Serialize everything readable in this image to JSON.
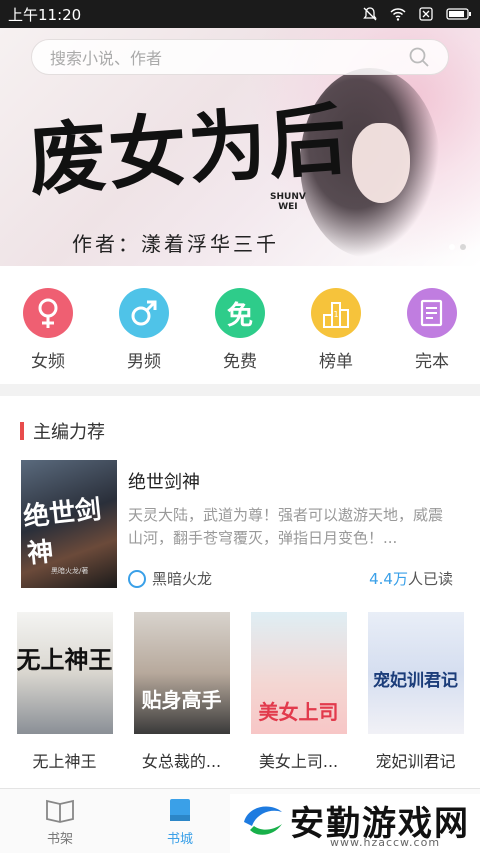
{
  "status_bar": {
    "time": "上午11:20"
  },
  "search": {
    "placeholder": "搜索小说、作者"
  },
  "banner": {
    "title": "废女为后",
    "pinyin_top": "SHUNV",
    "pinyin_bottom": "WEI",
    "author_line": "作者：漾着浮华三千"
  },
  "categories": [
    {
      "label": "女频",
      "color": "#ef5f72",
      "icon": "female-icon"
    },
    {
      "label": "男频",
      "color": "#4fc3e8",
      "icon": "male-icon"
    },
    {
      "label": "免费",
      "color": "#2ecc8a",
      "icon": "free-icon"
    },
    {
      "label": "榜单",
      "color": "#f6c33b",
      "icon": "ranking-icon"
    },
    {
      "label": "完本",
      "color": "#c07de0",
      "icon": "book-complete-icon"
    }
  ],
  "section": {
    "title": "主编力荐"
  },
  "featured": {
    "title": "绝世剑神",
    "description": "天灵大陆，武道为尊！强者可以遨游天地，威震山河，翻手苍穹覆灭，弹指日月变色！...",
    "author": "黑暗火龙",
    "reads_num": "4.4万",
    "reads_suffix": "人已读",
    "cover_title": "绝世剑神",
    "cover_sub": "黑暗火龙/著"
  },
  "books": [
    {
      "title": "无上神王",
      "cover_text": "无上神王",
      "cover_bg": "linear-gradient(180deg,#f4f4f2 0%,#d9d6cf 50%,#8a8f96 100%)",
      "cover_color": "#111"
    },
    {
      "title": "女总裁的...",
      "cover_text": "贴身高手",
      "cover_bg": "linear-gradient(180deg,#d8d3cd 0%,#b7a99c 50%,#3a3a3a 100%)",
      "cover_color": "#fff"
    },
    {
      "title": "美女上司...",
      "cover_text": "美女上司",
      "cover_bg": "linear-gradient(180deg,#dfeef4 0%,#f4d6d2 60%,#f7c6c6 100%)",
      "cover_color": "#e23a4c"
    },
    {
      "title": "宠妃训君记",
      "cover_text": "宠妃训君记",
      "cover_bg": "linear-gradient(180deg,#e9eef7 0%,#d5def0 50%,#f1f1f6 100%)",
      "cover_color": "#1c3d7a"
    }
  ],
  "tabs": [
    {
      "label": "书架",
      "icon": "bookshelf-icon",
      "active": false
    },
    {
      "label": "书城",
      "icon": "bookstore-icon",
      "active": true
    }
  ],
  "watermark": {
    "text": "安勤游戏网",
    "url": "www.hzaccw.com"
  }
}
